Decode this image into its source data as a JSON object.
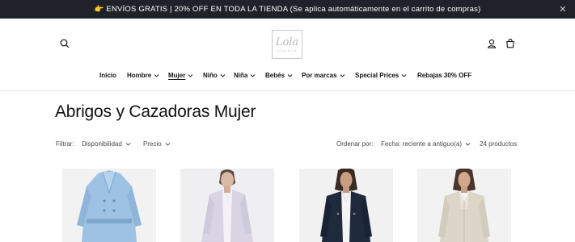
{
  "announcement": {
    "emoji": "👉",
    "text": "ENVÍOS GRATIS | 20% OFF EN TODA LA TIENDA (Se aplica automáticamente en el carrito de compras)",
    "close_icon": "close-icon"
  },
  "header": {
    "search_icon": "search-icon",
    "account_icon": "account-icon",
    "cart_icon": "cart-icon",
    "logo": {
      "script": "Lola",
      "sub": "LOLA & LIA"
    }
  },
  "nav": {
    "items": [
      {
        "label": "Inicio",
        "dropdown": false
      },
      {
        "label": "Hombre",
        "dropdown": true
      },
      {
        "label": "Mujer",
        "dropdown": true,
        "active": true
      },
      {
        "label": "Niño",
        "dropdown": true
      },
      {
        "label": "Niña",
        "dropdown": true
      },
      {
        "label": "Bebés",
        "dropdown": true
      },
      {
        "label": "Por marcas",
        "dropdown": true
      },
      {
        "label": "Special Prices",
        "dropdown": true
      },
      {
        "label": "Rebajas 30% OFF",
        "dropdown": false
      }
    ]
  },
  "collection": {
    "title": "Abrigos y Cazadoras Mujer"
  },
  "filters": {
    "filter_label": "Filtrar:",
    "availability": "Disponibilidad",
    "price": "Precio",
    "sort_label": "Ordenar por:",
    "sort_value": "Fecha: reciente a antiguo(a)",
    "count": "24 productos"
  },
  "products": [
    {
      "name": "light-blue trench coat",
      "colors": {
        "bg": "#f2f2f2",
        "garment": "#9ec2e3",
        "accent": "#7ea6cb"
      }
    },
    {
      "name": "lilac long coat",
      "colors": {
        "bg": "#efeff1",
        "garment": "#d9d4e4",
        "accent": "#5b4a44"
      }
    },
    {
      "name": "navy short jacket",
      "colors": {
        "bg": "#f1f1f1",
        "garment": "#1f2a3d",
        "accent": "#3a2a24"
      }
    },
    {
      "name": "beige short coat",
      "colors": {
        "bg": "#f2f2f2",
        "garment": "#dcd6c9",
        "accent": "#4a362c"
      }
    }
  ]
}
